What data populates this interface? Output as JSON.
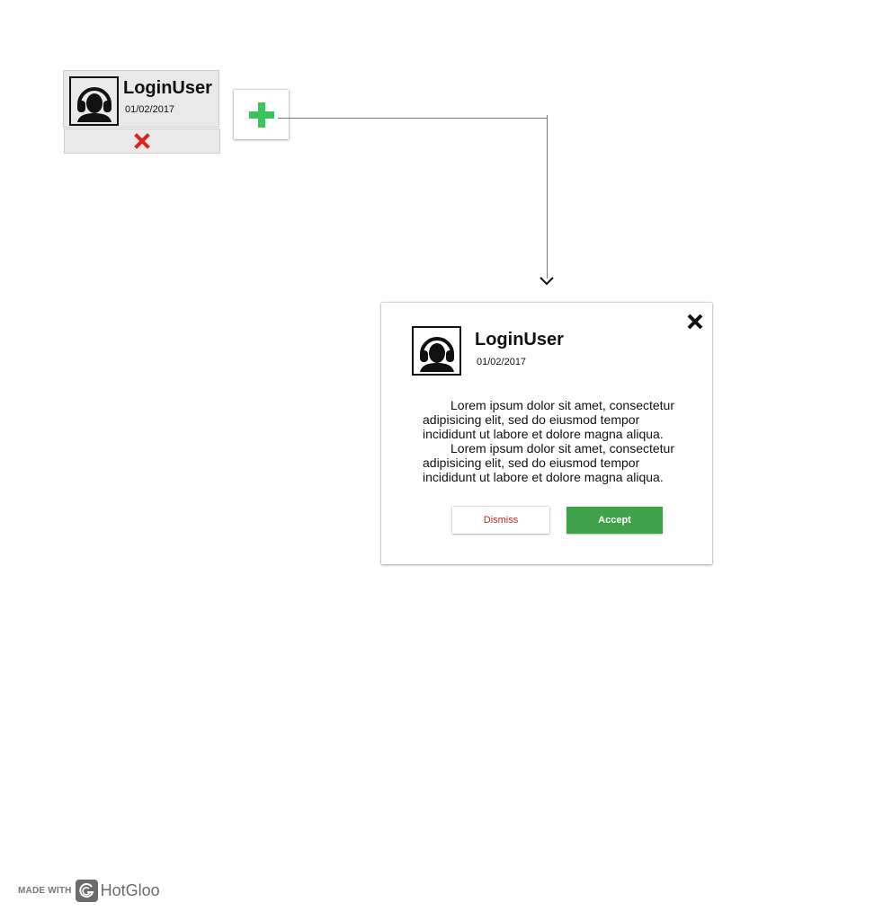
{
  "user_card": {
    "avatar_icon": "user-headset-icon",
    "name": "LoginUser",
    "date": "01/02/2017",
    "remove_icon": "close-x-icon",
    "remove_color": "#e02020"
  },
  "add_button": {
    "icon": "plus-icon",
    "color": "#3cc25a"
  },
  "dialog": {
    "avatar_icon": "user-headset-icon",
    "name": "LoginUser",
    "date": "01/02/2017",
    "close_icon": "close-x-icon",
    "paragraphs": [
      "Lorem ipsum dolor sit amet, consectetur adipisicing elit, sed do eiusmod tempor incididunt ut labore et dolore magna aliqua.",
      "Lorem ipsum dolor sit amet, consectetur adipisicing elit, sed do eiusmod tempor incididunt ut labore et dolore magna aliqua."
    ],
    "dismiss_label": "Dismiss",
    "accept_label": "Accept",
    "accept_color": "#3fa24a",
    "dismiss_color": "#d32222"
  },
  "footer": {
    "made_with": "MADE WITH",
    "brand": "HotGloo"
  }
}
